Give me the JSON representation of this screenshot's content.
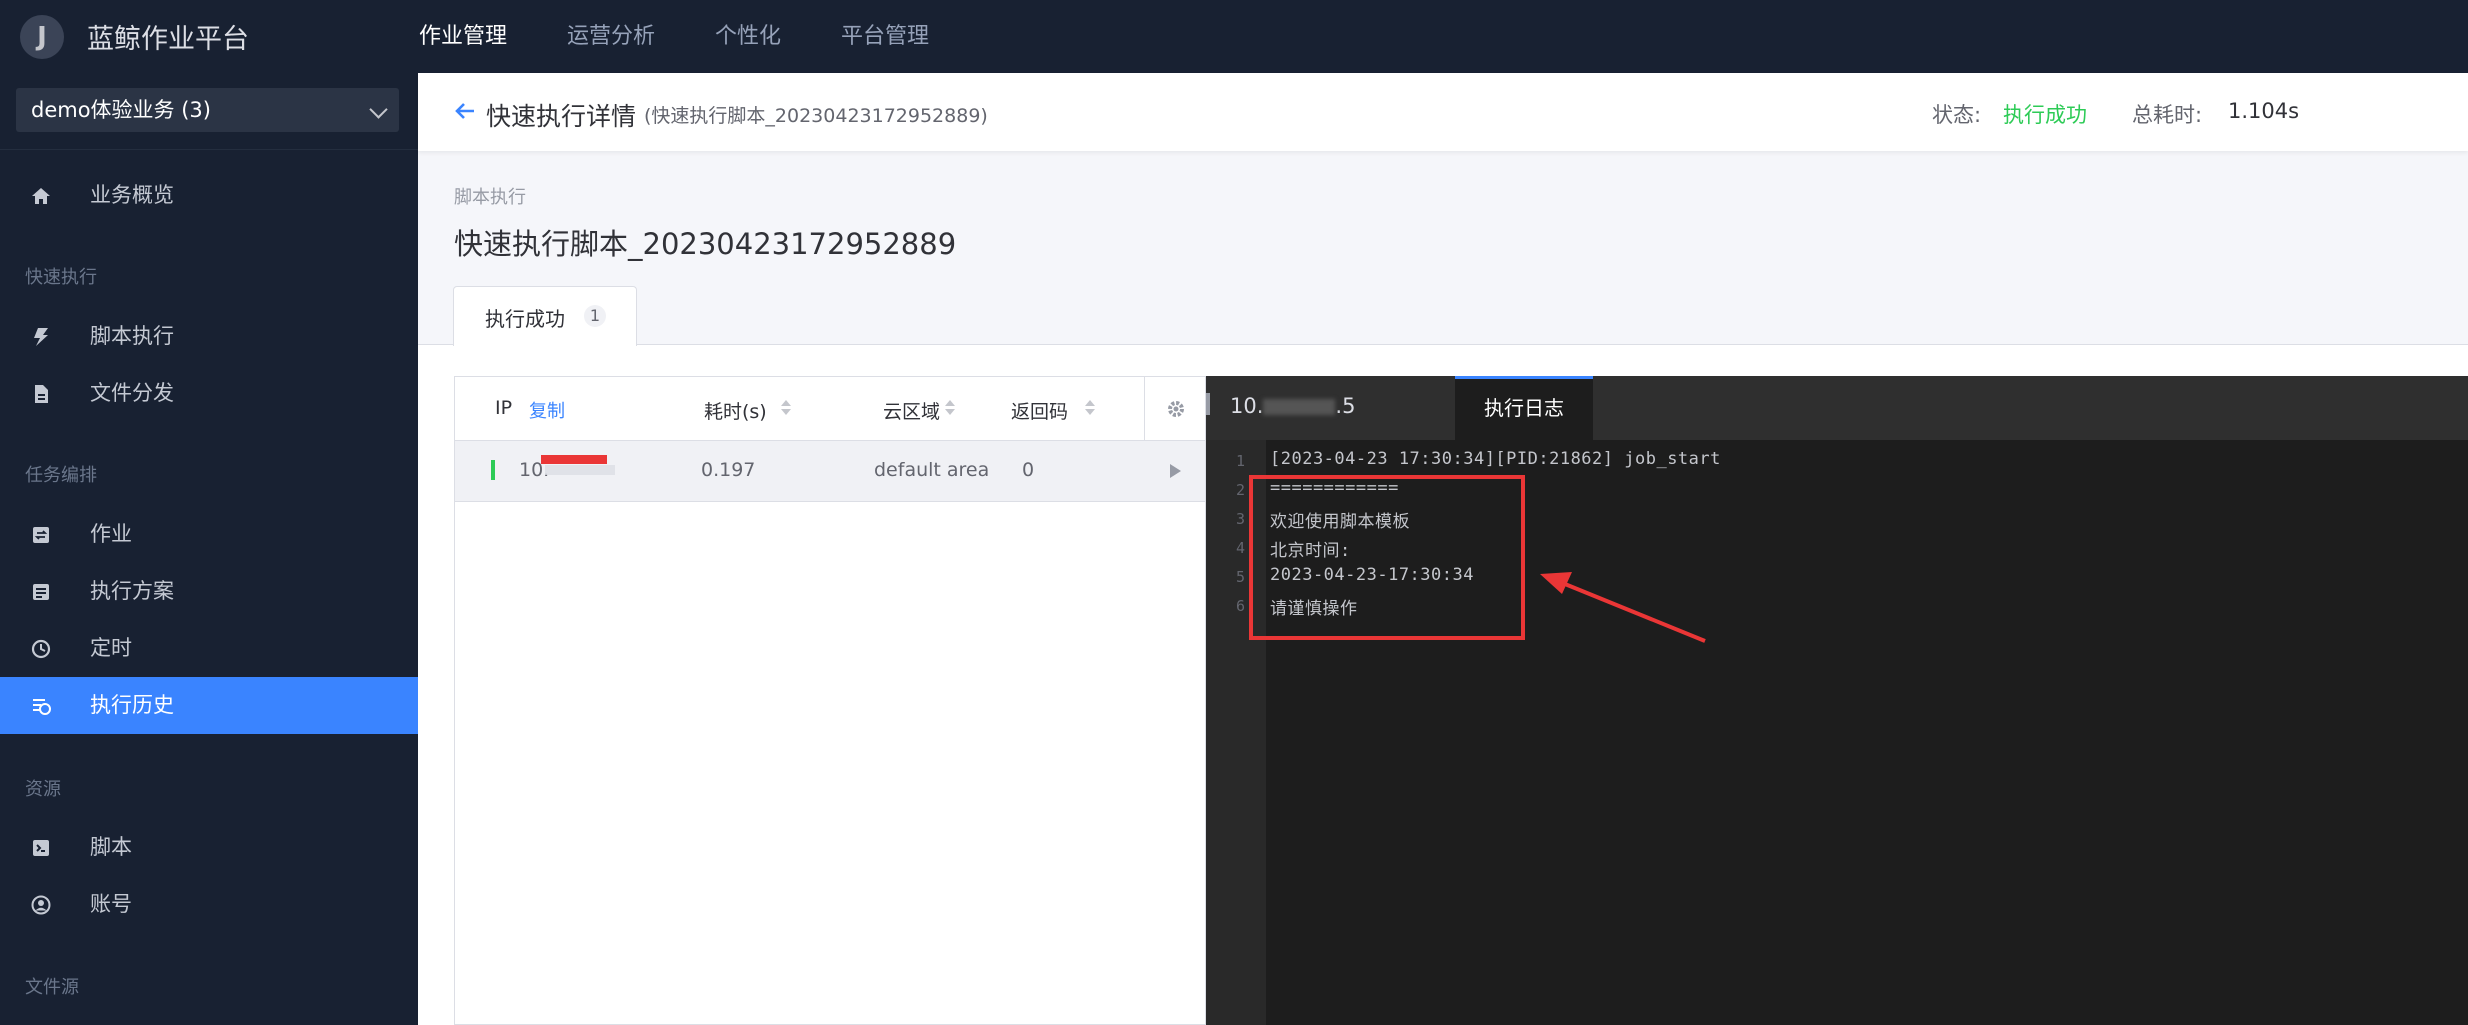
{
  "app": {
    "logo_letter": "J",
    "name": "蓝鲸作业平台"
  },
  "topnav": [
    {
      "label": "作业管理",
      "active": true
    },
    {
      "label": "运营分析"
    },
    {
      "label": "个性化"
    },
    {
      "label": "平台管理"
    }
  ],
  "sidebar": {
    "business_select": "demo体验业务 (3)",
    "overview": "业务概览",
    "groups": {
      "quick": "快速执行",
      "task": "任务编排",
      "resource": "资源",
      "file_source": "文件源"
    },
    "items": {
      "script_exec": "脚本执行",
      "file_dist": "文件分发",
      "job": "作业",
      "plan": "执行方案",
      "cron": "定时",
      "history": "执行历史",
      "script": "脚本",
      "account": "账号"
    }
  },
  "header": {
    "title": "快速执行详情",
    "subtitle": "(快速执行脚本_20230423172952889)",
    "status_label": "状态:",
    "status_value": "执行成功",
    "cost_label": "总耗时:",
    "cost_value": "1.104s"
  },
  "content": {
    "section_label": "脚本执行",
    "task_title": "快速执行脚本_20230423172952889",
    "tab": {
      "label": "执行成功",
      "count": "1"
    }
  },
  "host_table": {
    "columns": {
      "ip": "IP",
      "copy": "复制",
      "cost": "耗时(s)",
      "cloud": "云区域",
      "code": "返回码"
    },
    "rows": [
      {
        "ip": "10.",
        "cost": "0.197",
        "cloud": "default area",
        "code": "0"
      }
    ]
  },
  "log_panel": {
    "ip_tab": "10.",
    "ip_tab_suffix": ".5",
    "active_tab": "执行日志",
    "lines": [
      {
        "n": "1",
        "text": "[2023-04-23 17:30:34][PID:21862] job_start"
      },
      {
        "n": "2",
        "text": "============"
      },
      {
        "n": "3",
        "text": "欢迎使用脚本模板"
      },
      {
        "n": "4",
        "text": "北京时间:"
      },
      {
        "n": "5",
        "text": "2023-04-23-17:30:34"
      },
      {
        "n": "6",
        "text": "请谨慎操作"
      }
    ]
  },
  "colors": {
    "nav_bg": "#182132",
    "accent": "#3a84ff",
    "success": "#2dcb56",
    "annotation": "#ea3636"
  }
}
